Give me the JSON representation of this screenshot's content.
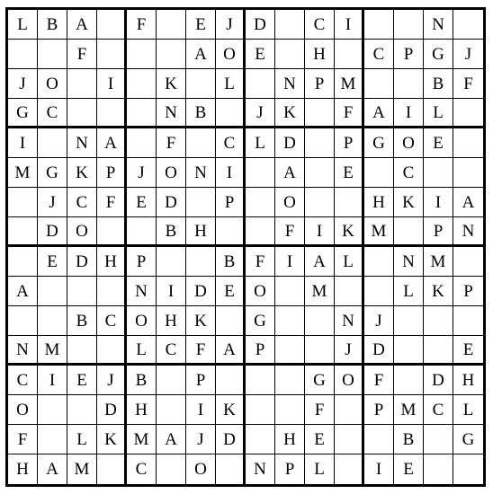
{
  "puzzle": {
    "size": 16,
    "box": 4,
    "grid": [
      [
        "L",
        "B",
        "A",
        "",
        "F",
        "",
        "E",
        "J",
        "D",
        "",
        "C",
        "I",
        "",
        "",
        "N",
        ""
      ],
      [
        "",
        "",
        "F",
        "",
        "",
        "",
        "A",
        "O",
        "E",
        "",
        "H",
        "",
        "C",
        "P",
        "G",
        "J"
      ],
      [
        "J",
        "O",
        "",
        "I",
        "",
        "K",
        "",
        "L",
        "",
        "N",
        "P",
        "M",
        "",
        "",
        "B",
        "F"
      ],
      [
        "G",
        "C",
        "",
        "",
        "",
        "N",
        "B",
        "",
        "J",
        "K",
        "",
        "F",
        "A",
        "I",
        "L",
        ""
      ],
      [
        "I",
        "",
        "N",
        "A",
        "",
        "F",
        "",
        "C",
        "L",
        "D",
        "",
        "P",
        "G",
        "O",
        "E",
        ""
      ],
      [
        "M",
        "G",
        "K",
        "P",
        "J",
        "O",
        "N",
        "I",
        "",
        "A",
        "",
        "E",
        "",
        "C",
        "",
        ""
      ],
      [
        "",
        "J",
        "C",
        "F",
        "E",
        "D",
        "",
        "P",
        "",
        "O",
        "",
        "",
        "H",
        "K",
        "I",
        "A"
      ],
      [
        "",
        "D",
        "O",
        "",
        "",
        "B",
        "H",
        "",
        "",
        "F",
        "I",
        "K",
        "M",
        "",
        "P",
        "N"
      ],
      [
        "",
        "E",
        "D",
        "H",
        "P",
        "",
        "",
        "B",
        "F",
        "I",
        "A",
        "L",
        "",
        "N",
        "M",
        ""
      ],
      [
        "A",
        "",
        "",
        "",
        "N",
        "I",
        "D",
        "E",
        "O",
        "",
        "M",
        "",
        "",
        "L",
        "K",
        "P"
      ],
      [
        "",
        "",
        "B",
        "C",
        "O",
        "H",
        "K",
        "",
        "G",
        "",
        "",
        "N",
        "J",
        "",
        "",
        ""
      ],
      [
        "N",
        "M",
        "",
        "",
        "L",
        "C",
        "F",
        "A",
        "P",
        "",
        "",
        "J",
        "D",
        "",
        "",
        "E"
      ],
      [
        "C",
        "I",
        "E",
        "J",
        "B",
        "",
        "P",
        "",
        "",
        "",
        "G",
        "O",
        "F",
        "",
        "D",
        "H"
      ],
      [
        "O",
        "",
        "",
        "D",
        "H",
        "",
        "I",
        "K",
        "",
        "",
        "F",
        "",
        "P",
        "M",
        "C",
        "L"
      ],
      [
        "F",
        "",
        "L",
        "K",
        "M",
        "A",
        "J",
        "D",
        "",
        "H",
        "E",
        "",
        "",
        "B",
        "",
        "G"
      ],
      [
        "H",
        "A",
        "M",
        "",
        "C",
        "",
        "O",
        "",
        "N",
        "P",
        "L",
        "",
        "I",
        "E",
        "",
        ""
      ]
    ]
  }
}
